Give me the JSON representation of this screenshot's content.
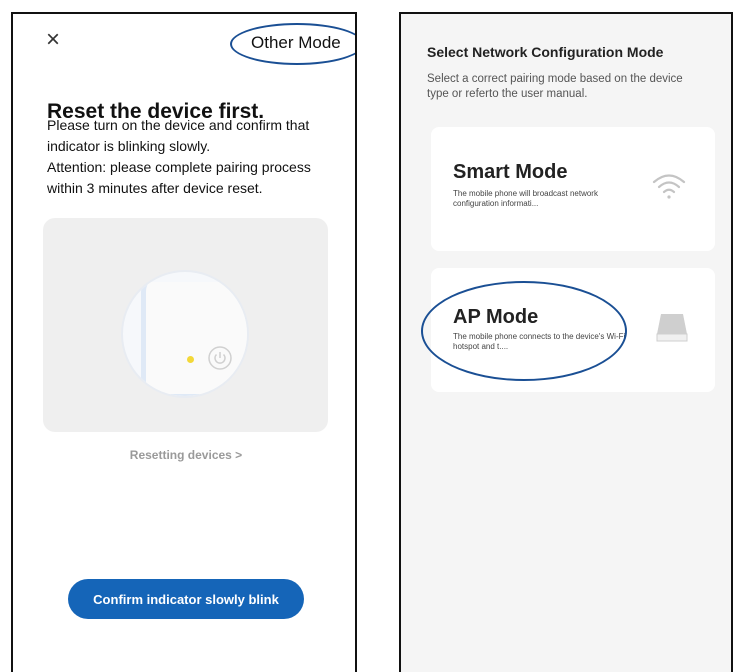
{
  "left_screen": {
    "close_icon": "×",
    "other_mode_label": "Other Mode",
    "title": "Reset the device first.",
    "description_line1": "Please turn on the device and confirm that indicator is blinking slowly.",
    "description_line2": "Attention: please complete pairing process within 3 minutes after device reset.",
    "resetting_link": "Resetting devices >",
    "confirm_button": "Confirm indicator slowly blink",
    "icons": [
      "close-icon",
      "power-icon"
    ],
    "colors": {
      "accent": "#1565b8",
      "highlight_ellipse": "#1a4f94",
      "led": "#f3d838"
    }
  },
  "right_screen": {
    "title": "Select Network Configuration Mode",
    "subtitle": "Select a correct pairing mode based on the device type or referto the user manual.",
    "modes": [
      {
        "title": "Smart Mode",
        "description": "The mobile phone will broadcast network configuration informati...",
        "icon": "wifi-icon"
      },
      {
        "title": "AP Mode",
        "description": "The mobile phone connects to the device's Wi-Fi hotspot and t....",
        "icon": "router-icon"
      }
    ]
  }
}
